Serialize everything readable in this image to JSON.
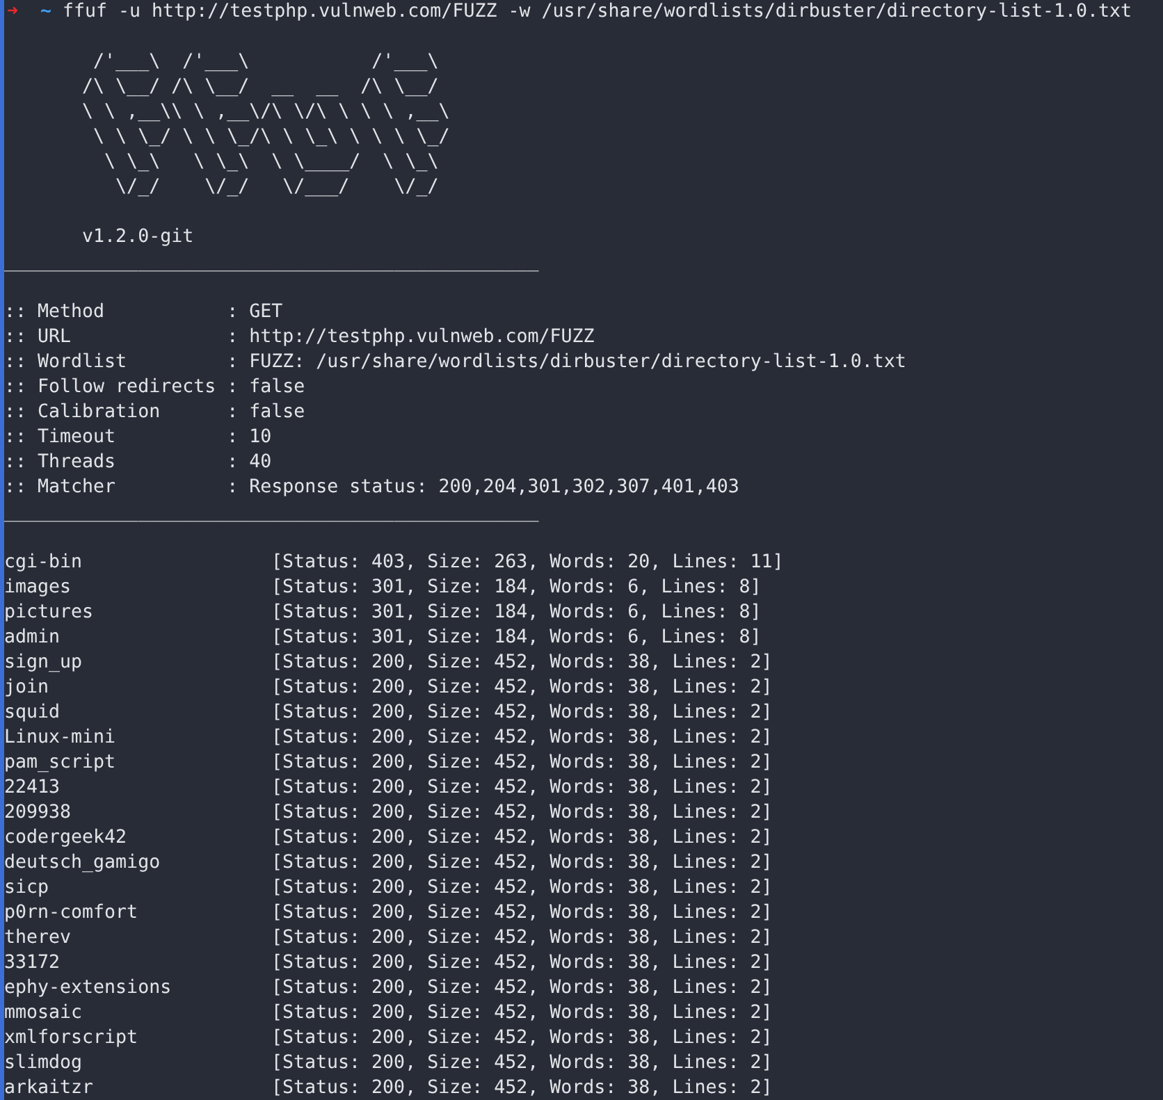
{
  "prompt": {
    "arrow": "➜",
    "cwd": "~",
    "command": "ffuf -u http://testphp.vulnweb.com/FUZZ -w /usr/share/wordlists/dirbuster/directory-list-1.0.txt"
  },
  "banner": [
    "        /'___\\  /'___\\           /'___\\",
    "       /\\ \\__/ /\\ \\__/  __  __  /\\ \\__/",
    "       \\ \\ ,__\\\\ \\ ,__\\/\\ \\/\\ \\ \\ \\ ,__\\",
    "        \\ \\ \\_/ \\ \\ \\_/\\ \\ \\_\\ \\ \\ \\ \\_/",
    "         \\ \\_\\   \\ \\_\\  \\ \\____/  \\ \\_\\",
    "          \\/_/    \\/_/   \\/___/    \\/_/"
  ],
  "version": "       v1.2.0-git",
  "separator_top": "________________________________________________",
  "config": [
    ":: Method           : GET",
    ":: URL              : http://testphp.vulnweb.com/FUZZ",
    ":: Wordlist         : FUZZ: /usr/share/wordlists/dirbuster/directory-list-1.0.txt",
    ":: Follow redirects : false",
    ":: Calibration      : false",
    ":: Timeout          : 10",
    ":: Threads          : 40",
    ":: Matcher          : Response status: 200,204,301,302,307,401,403"
  ],
  "separator_bottom": "________________________________________________",
  "results": [
    {
      "path": "cgi-bin",
      "info": "[Status: 403, Size: 263, Words: 20, Lines: 11]"
    },
    {
      "path": "images",
      "info": "[Status: 301, Size: 184, Words: 6, Lines: 8]"
    },
    {
      "path": "pictures",
      "info": "[Status: 301, Size: 184, Words: 6, Lines: 8]"
    },
    {
      "path": "admin",
      "info": "[Status: 301, Size: 184, Words: 6, Lines: 8]"
    },
    {
      "path": "sign_up",
      "info": "[Status: 200, Size: 452, Words: 38, Lines: 2]"
    },
    {
      "path": "join",
      "info": "[Status: 200, Size: 452, Words: 38, Lines: 2]"
    },
    {
      "path": "squid",
      "info": "[Status: 200, Size: 452, Words: 38, Lines: 2]"
    },
    {
      "path": "Linux-mini",
      "info": "[Status: 200, Size: 452, Words: 38, Lines: 2]"
    },
    {
      "path": "pam_script",
      "info": "[Status: 200, Size: 452, Words: 38, Lines: 2]"
    },
    {
      "path": "22413",
      "info": "[Status: 200, Size: 452, Words: 38, Lines: 2]"
    },
    {
      "path": "209938",
      "info": "[Status: 200, Size: 452, Words: 38, Lines: 2]"
    },
    {
      "path": "codergeek42",
      "info": "[Status: 200, Size: 452, Words: 38, Lines: 2]"
    },
    {
      "path": "deutsch_gamigo",
      "info": "[Status: 200, Size: 452, Words: 38, Lines: 2]"
    },
    {
      "path": "sicp",
      "info": "[Status: 200, Size: 452, Words: 38, Lines: 2]"
    },
    {
      "path": "p0rn-comfort",
      "info": "[Status: 200, Size: 452, Words: 38, Lines: 2]"
    },
    {
      "path": "therev",
      "info": "[Status: 200, Size: 452, Words: 38, Lines: 2]"
    },
    {
      "path": "33172",
      "info": "[Status: 200, Size: 452, Words: 38, Lines: 2]"
    },
    {
      "path": "ephy-extensions",
      "info": "[Status: 200, Size: 452, Words: 38, Lines: 2]"
    },
    {
      "path": "mmosaic",
      "info": "[Status: 200, Size: 452, Words: 38, Lines: 2]"
    },
    {
      "path": "xmlforscript",
      "info": "[Status: 200, Size: 452, Words: 38, Lines: 2]"
    },
    {
      "path": "slimdog",
      "info": "[Status: 200, Size: 452, Words: 38, Lines: 2]"
    },
    {
      "path": "arkaitzr",
      "info": "[Status: 200, Size: 452, Words: 38, Lines: 2]"
    }
  ]
}
